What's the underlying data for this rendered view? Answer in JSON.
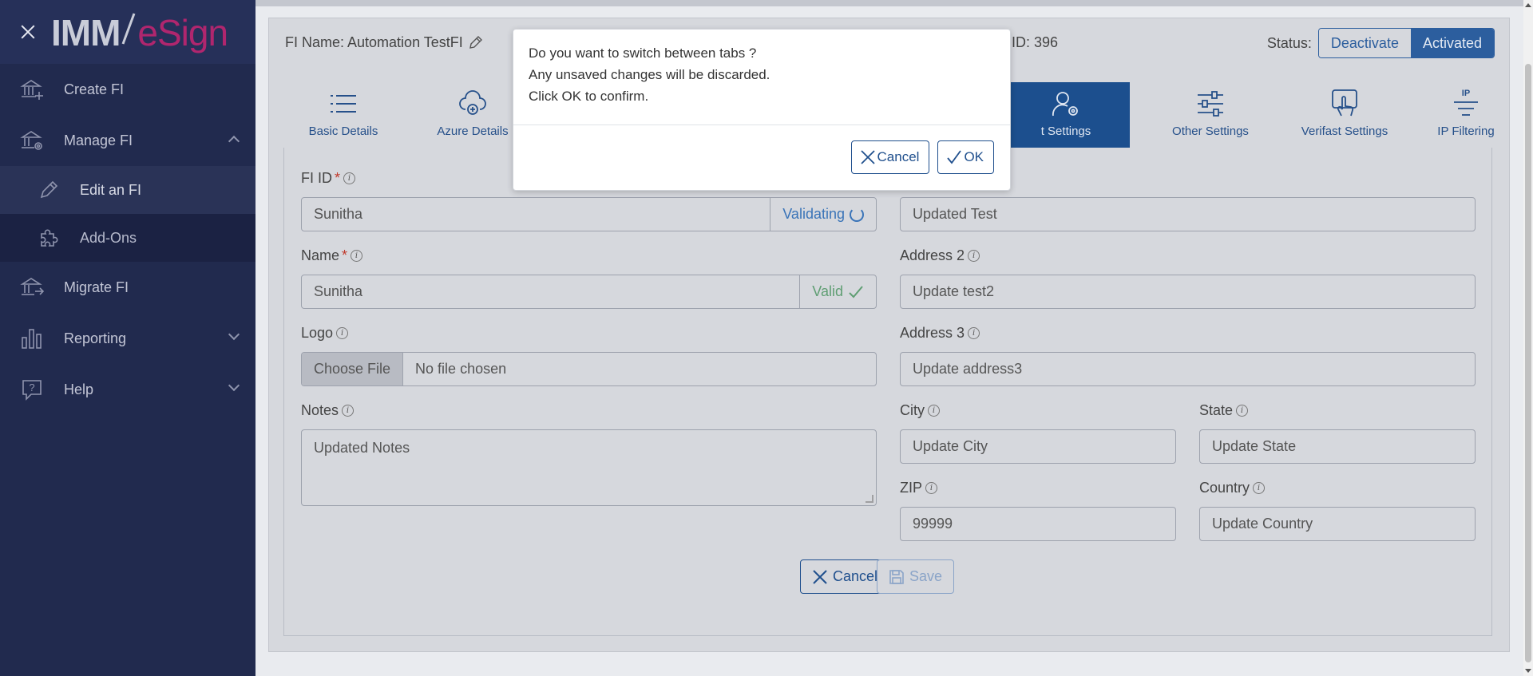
{
  "app": {
    "logo_part1": "IMM",
    "logo_part2": "eSign"
  },
  "sidebar": {
    "items": [
      {
        "label": "Create FI",
        "icon": "bank-plus-icon"
      },
      {
        "label": "Manage FI",
        "icon": "bank-gear-icon",
        "expanded": true,
        "children": [
          {
            "label": "Edit an FI",
            "icon": "pencil-icon",
            "active": true
          },
          {
            "label": "Add-Ons",
            "icon": "puzzle-icon"
          }
        ]
      },
      {
        "label": "Migrate FI",
        "icon": "bank-arrow-icon"
      },
      {
        "label": "Reporting",
        "icon": "bar-chart-icon",
        "expandable": true
      },
      {
        "label": "Help",
        "icon": "help-bubble-icon",
        "expandable": true
      }
    ]
  },
  "header": {
    "fi_name": "FI Name: Automation TestFI",
    "fi_id_text": "ID: 396",
    "status_label": "Status:",
    "deactivate_label": "Deactivate",
    "activated_label": "Activated",
    "active_status": "Activated"
  },
  "tabs": [
    {
      "label": "Basic Details",
      "icon": "list-icon"
    },
    {
      "label": "Azure Details",
      "icon": "cloud-icon"
    },
    {
      "label": "t Settings",
      "icon": "user-gear-icon",
      "active": true
    },
    {
      "label": "Other Settings",
      "icon": "sliders-icon"
    },
    {
      "label": "Verifast Settings",
      "icon": "hand-touch-icon"
    },
    {
      "label": "IP Filtering",
      "icon": "ip-filter-icon"
    }
  ],
  "form": {
    "fi_id": {
      "label": "FI ID",
      "required_mark": "*",
      "value": "Sunitha",
      "status": "Validating"
    },
    "name": {
      "label": "Name",
      "required_mark": "*",
      "value": "Sunitha",
      "status": "Valid"
    },
    "logo": {
      "label": "Logo",
      "button": "Choose File",
      "value": "No file chosen"
    },
    "notes": {
      "label": "Notes",
      "value": "Updated Notes"
    },
    "address1": {
      "value": "Updated Test"
    },
    "address2": {
      "label": "Address 2",
      "value": "Update test2"
    },
    "address3": {
      "label": "Address 3",
      "value": "Update address3"
    },
    "city": {
      "label": "City",
      "value": "Update City"
    },
    "state": {
      "label": "State",
      "value": "Update State"
    },
    "zip": {
      "label": "ZIP",
      "value": "99999"
    },
    "country": {
      "label": "Country",
      "value": "Update Country"
    },
    "cancel_label": "Cancel",
    "save_label": "Save"
  },
  "modal": {
    "line1": "Do you want to switch between tabs ?",
    "line2": "Any unsaved changes will be discarded.",
    "line3": "Click OK to confirm.",
    "cancel_label": "Cancel",
    "ok_label": "OK"
  },
  "colors": {
    "sidebar_bg": "#212a4e",
    "primary": "#1f4f8d",
    "logo_accent": "#b0266e",
    "valid": "#5f9e73"
  }
}
